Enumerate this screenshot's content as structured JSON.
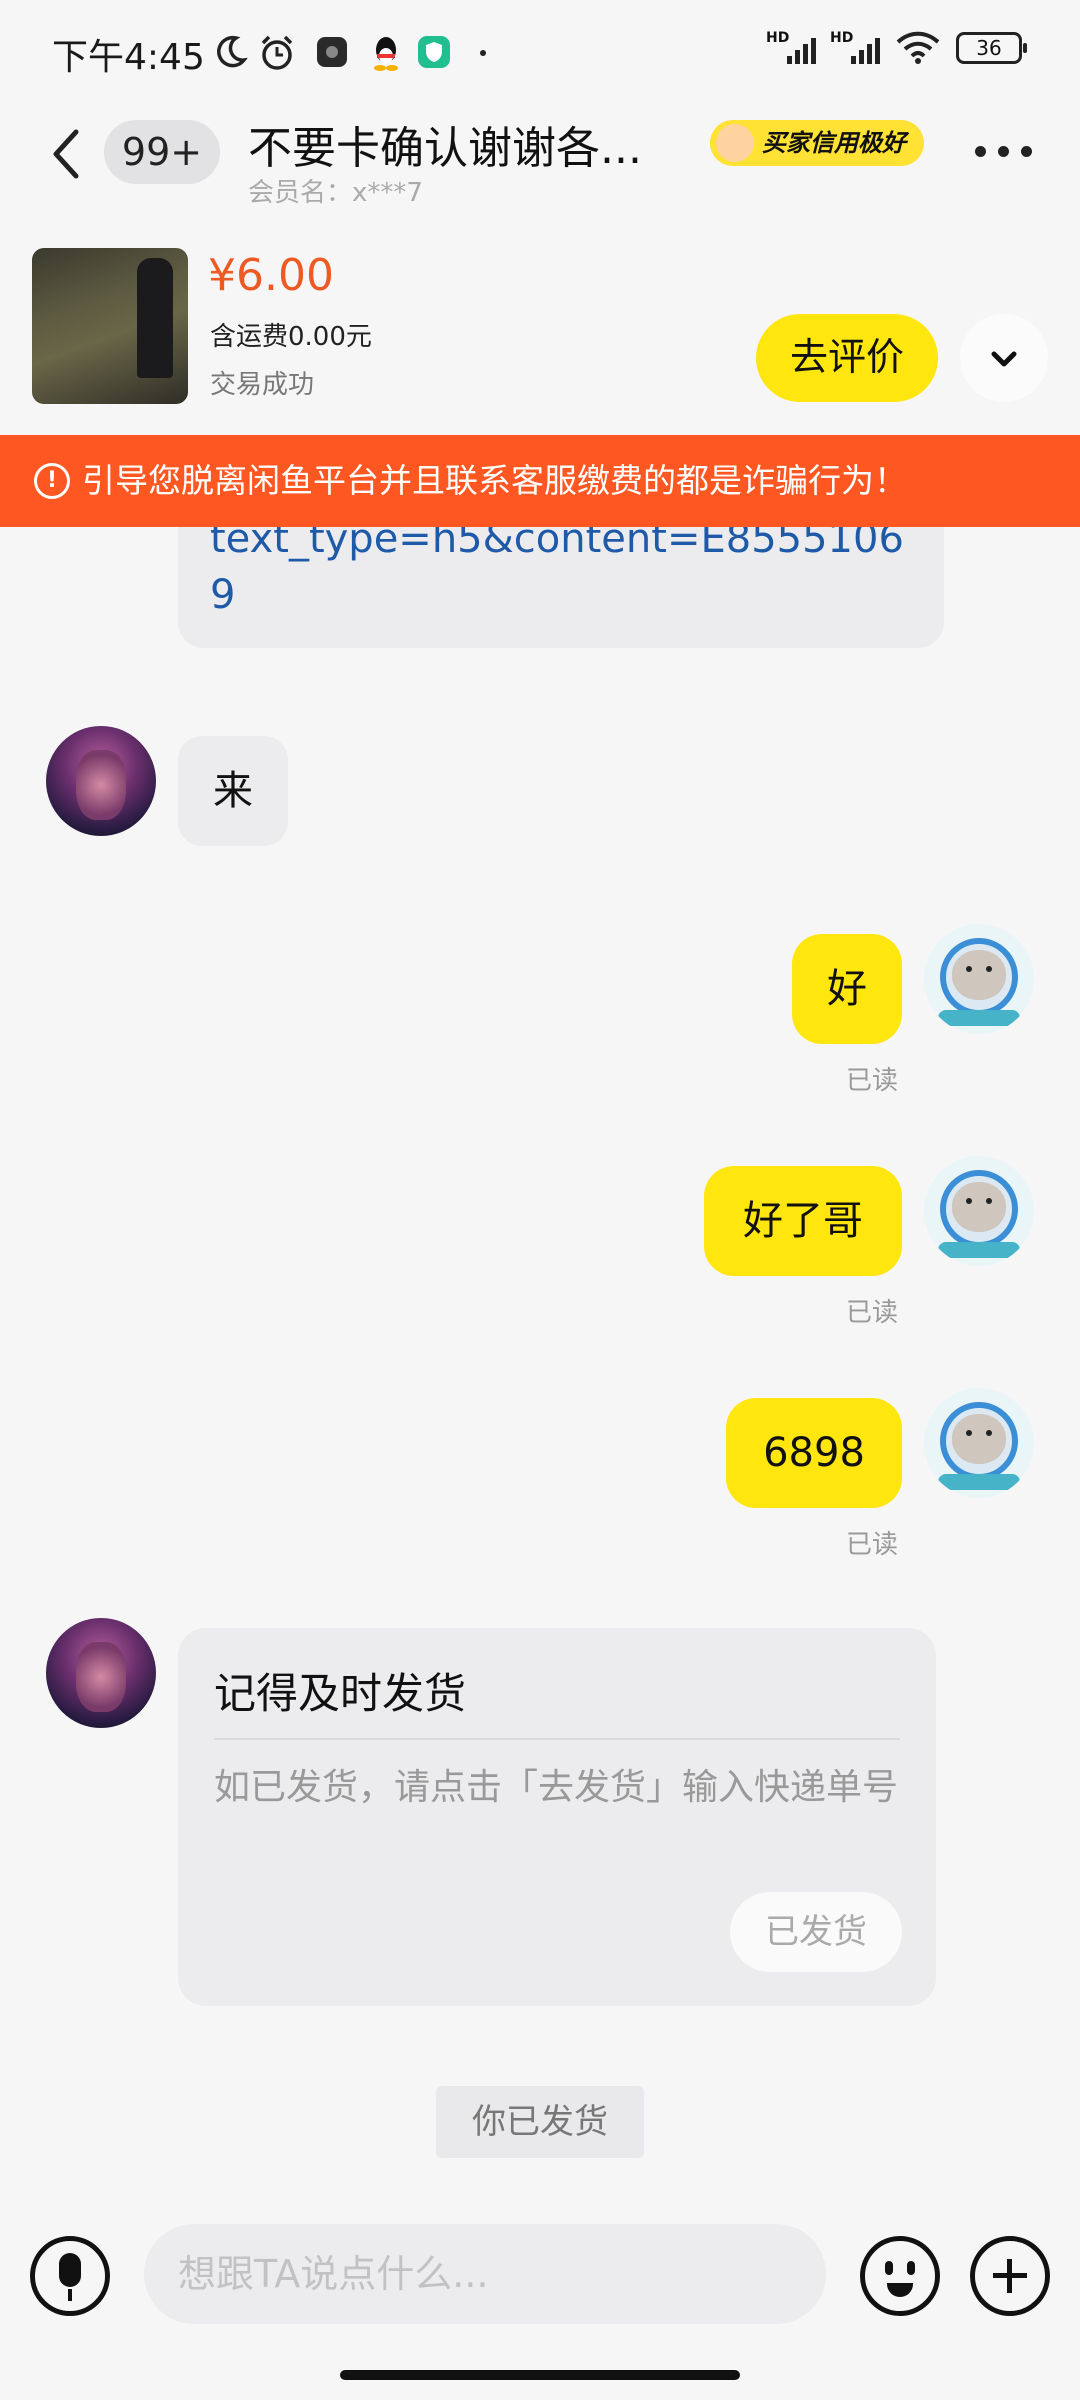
{
  "status_bar": {
    "time": "下午4:45",
    "hd_label": "HD",
    "battery": "36"
  },
  "header": {
    "unread_count": "99+",
    "title": "不要卡确认谢谢各...",
    "member": "会员名：x***7",
    "credit_badge": "买家信用极好"
  },
  "order": {
    "price": "¥6.00",
    "shipping": "含运费0.00元",
    "status": "交易成功",
    "review_button": "去评价"
  },
  "warning": {
    "text": "引导您脱离闲鱼平台并且联系客服缴费的都是诈骗行为！"
  },
  "chat": {
    "link_line1": "text_type=h5&content=E8555106",
    "link_line2": "9",
    "msg1": "来",
    "msg2": "好",
    "msg3": "好了哥",
    "msg4": "6898",
    "read_label": "已读",
    "card": {
      "title": "记得及时发货",
      "description": "如已发货，请点击「去发货」输入快递单号",
      "button": "已发货"
    },
    "system_notice": "你已发货"
  },
  "input": {
    "placeholder": "想跟TA说点什么..."
  },
  "colors": {
    "accent_yellow": "#ffe60f",
    "price_orange": "#ee5a24",
    "warning_bg": "#ff5722"
  }
}
